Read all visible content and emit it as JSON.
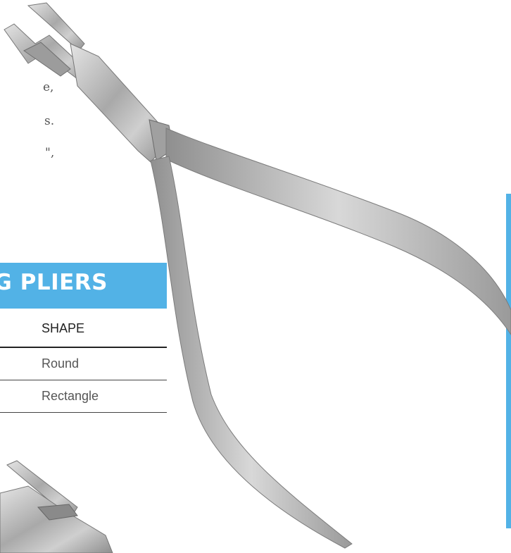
{
  "text_fragments": [
    {
      "key": "line1",
      "text": "e,"
    },
    {
      "key": "line2",
      "text": "s."
    },
    {
      "key": "line3",
      "text": "\","
    }
  ],
  "banner": {
    "title": "NG PLIERS"
  },
  "table": {
    "header": "SHAPE",
    "rows": [
      {
        "shape": "Round"
      },
      {
        "shape": "Rectangle"
      }
    ]
  },
  "colors": {
    "accent": "#52b2e6",
    "steel": "#b8b8b8",
    "text": "#555555"
  },
  "images": [
    "main-pliers-image",
    "pliers-detail-image"
  ]
}
